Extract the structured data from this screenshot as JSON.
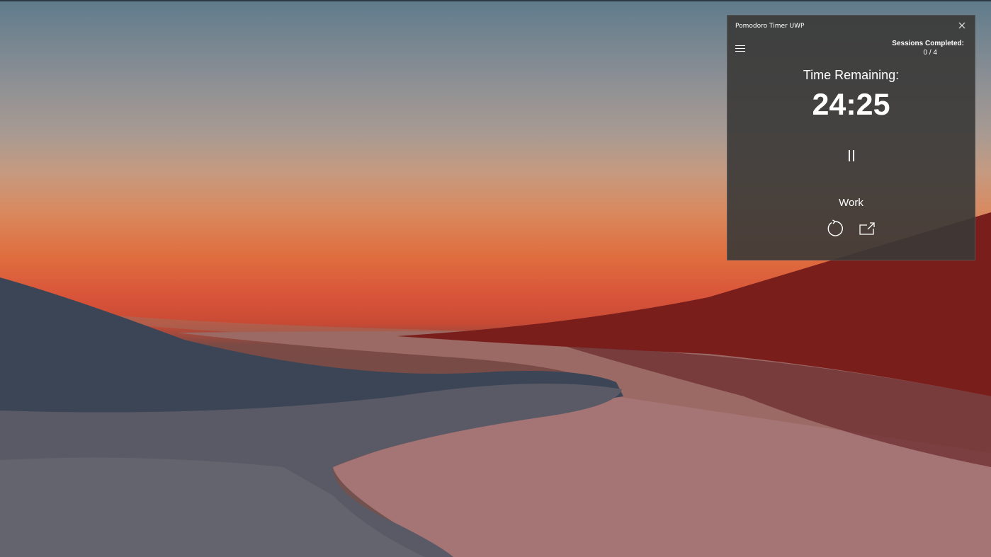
{
  "window": {
    "title": "Pomodoro Timer UWP",
    "close_icon": "close-icon"
  },
  "sessions": {
    "label": "Sessions Completed:",
    "value": "0 / 4"
  },
  "timer": {
    "label": "Time Remaining:",
    "value": "24:25"
  },
  "controls": {
    "pause_icon": "pause-icon",
    "mode": "Work",
    "reset_icon": "reset-icon",
    "popout_icon": "popout-icon"
  },
  "colors": {
    "window_bg": "#3a3837",
    "text": "#ffffff"
  }
}
